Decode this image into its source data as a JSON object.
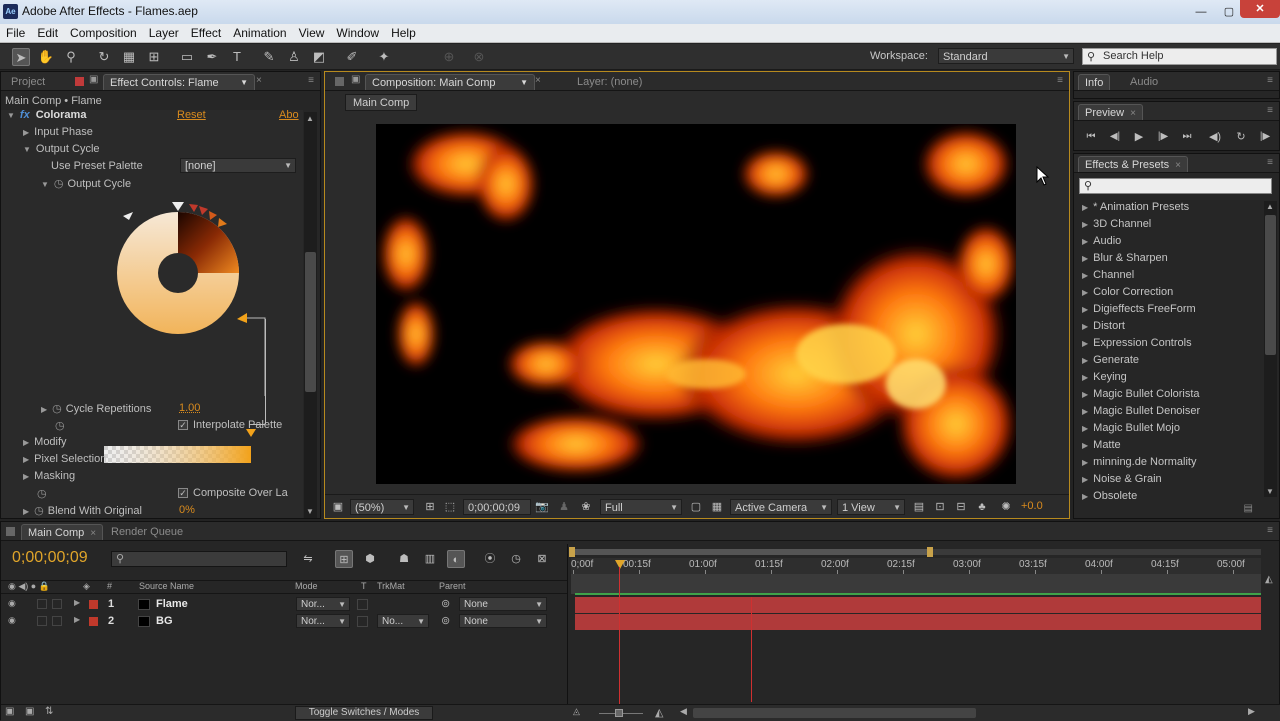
{
  "window": {
    "title": "Adobe After Effects - Flames.aep",
    "app_badge": "Ae",
    "min": "—",
    "max": "▢",
    "close": "✕"
  },
  "menu": [
    "File",
    "Edit",
    "Composition",
    "Layer",
    "Effect",
    "Animation",
    "View",
    "Window",
    "Help"
  ],
  "toolbar": {
    "workspace_label": "Workspace:",
    "workspace_value": "Standard",
    "search_placeholder": "Search Help"
  },
  "left_panel": {
    "tabs": [
      "Project",
      "Effect Controls: Flame"
    ],
    "breadcrumb": "Main Comp • Flame",
    "fx_label": "fx",
    "effect_name": "Colorama",
    "reset": "Reset",
    "about": "Abo",
    "rows": {
      "input_phase": "Input Phase",
      "output_cycle": "Output Cycle",
      "use_preset_palette": "Use Preset Palette",
      "preset_value": "[none]",
      "output_cycle_sub": "Output Cycle",
      "cycle_repetitions": "Cycle Repetitions",
      "cycle_repetitions_value": "1.00",
      "interpolate_palette": "Interpolate Palette",
      "modify": "Modify",
      "pixel_selection": "Pixel Selection",
      "masking": "Masking",
      "composite_over_layer": "Composite Over La",
      "blend_with_original": "Blend With Original",
      "blend_value": "0%"
    }
  },
  "comp_panel": {
    "tabs": [
      "Composition: Main Comp",
      "Layer: (none)"
    ],
    "subtab": "Main Comp",
    "footer": {
      "zoom": "(50%)",
      "timecode": "0;00;00;09",
      "resolution": "Full",
      "camera": "Active Camera",
      "view": "1 View",
      "exposure": "+0.0"
    }
  },
  "right_panel": {
    "info_tabs": [
      "Info",
      "Audio"
    ],
    "preview_tab": "Preview",
    "effects_tab": "Effects & Presets",
    "effects_items": [
      "* Animation Presets",
      "3D Channel",
      "Audio",
      "Blur & Sharpen",
      "Channel",
      "Color Correction",
      "Digieffects FreeForm",
      "Distort",
      "Expression Controls",
      "Generate",
      "Keying",
      "Magic Bullet Colorista",
      "Magic Bullet Denoiser",
      "Magic Bullet Mojo",
      "Matte",
      "minning.de Normality",
      "Noise & Grain",
      "Obsolete"
    ]
  },
  "timeline": {
    "tabs": [
      "Main Comp",
      "Render Queue"
    ],
    "timecode": "0;00;00;09",
    "columns": {
      "num": "#",
      "source": "Source Name",
      "mode": "Mode",
      "t": "T",
      "trkmat": "TrkMat",
      "parent": "Parent"
    },
    "layers": [
      {
        "num": "1",
        "name": "Flame",
        "mode": "Nor...",
        "trkmat": "",
        "parent": "None"
      },
      {
        "num": "2",
        "name": "BG",
        "mode": "Nor...",
        "trkmat": "No...",
        "parent": "None"
      }
    ],
    "ruler": [
      "0;00f",
      "00:15f",
      "01:00f",
      "01:15f",
      "02:00f",
      "02:15f",
      "03:00f",
      "03:15f",
      "04:00f",
      "04:15f",
      "05:00f"
    ],
    "toggle_label": "Toggle Switches / Modes",
    "colors": {
      "layer_bar": "#b03a3a",
      "timecode": "#e0a52a",
      "label_red": "#c0392b"
    }
  }
}
